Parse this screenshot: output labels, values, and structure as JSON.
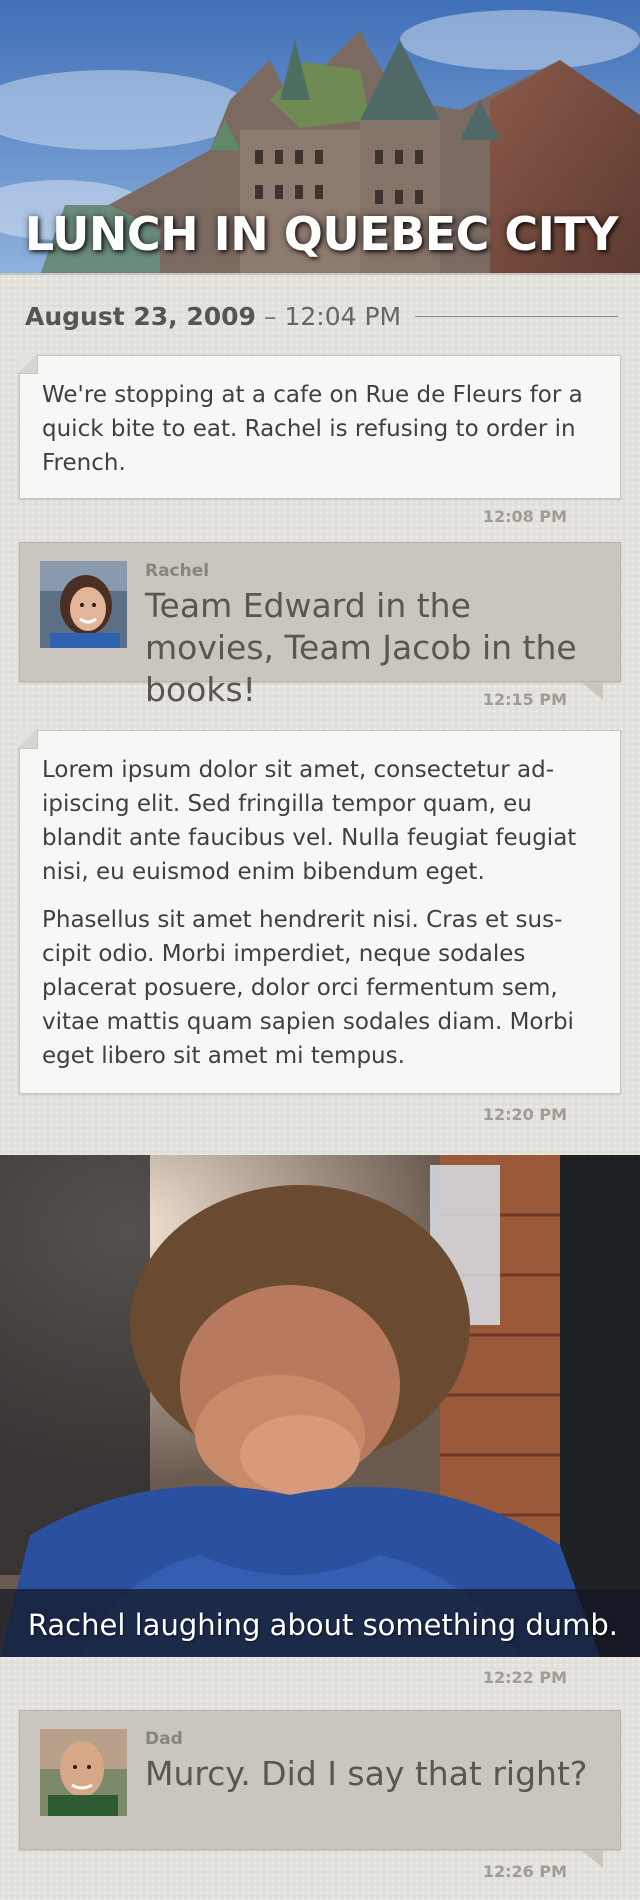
{
  "header": {
    "title": "LUNCH IN QUEBEC CITY"
  },
  "date_row": {
    "date": "August 23, 2009",
    "separator": "–",
    "time": "12:04 PM"
  },
  "entries": [
    {
      "type": "note",
      "paragraphs": [
        "We're stopping at a cafe on Rue de Fleurs for a quick bite to eat. Rachel is refusing to order in French."
      ],
      "timestamp": "12:08 PM"
    },
    {
      "type": "message",
      "sender": "Rachel",
      "text": "Team Edward in the movies, Team Jacob in the books!",
      "timestamp": "12:15 PM"
    },
    {
      "type": "note",
      "paragraphs": [
        "Lorem ipsum dolor sit amet, consectetur ad­ipiscing elit. Sed fringilla tempor quam, eu blandit ante faucibus vel. Nulla feugiat feugiat nisi, eu euismod enim bibendum eget.",
        "Phasellus sit amet hendrerit nisi. Cras et sus­cipit odio. Morbi imperdiet, neque sodales placerat posuere, dolor orci fermentum sem, vitae mattis quam sapien sodales diam. Morbi eget libero sit amet mi tempus."
      ],
      "timestamp": "12:20 PM"
    },
    {
      "type": "photo",
      "caption": "Rachel laughing about something dumb.",
      "timestamp": "12:22 PM"
    },
    {
      "type": "message",
      "sender": "Dad",
      "text": "Murcy. Did I say that right?",
      "timestamp": "12:26 PM"
    }
  ],
  "colors": {
    "background": "#e4e2dc",
    "note_card": "#f7f7f5",
    "message_card": "#cac6bf",
    "timestamp": "#a09d96"
  }
}
